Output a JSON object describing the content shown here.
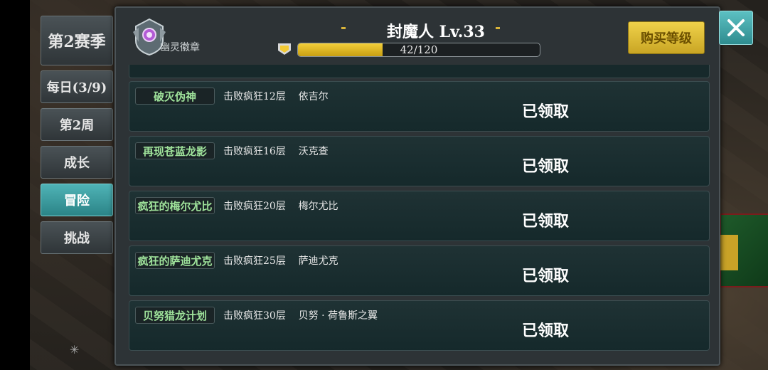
{
  "sidebar": {
    "season": "第2赛季",
    "daily": "每日(3/9)",
    "week": "第2周",
    "growth": "成长",
    "adventure": "冒险",
    "challenge": "挑战"
  },
  "header": {
    "badge_label": "幽灵徽章",
    "title": "封魔人 Lv.33",
    "xp_text": "42/120",
    "xp_progress": 0.35,
    "buy_label": "购买等级"
  },
  "quests": [
    {
      "name": "破灭伪神",
      "desc": "击败疯狂12层    依吉尔",
      "status": "已领取"
    },
    {
      "name": "再现苍蓝龙影",
      "desc": "击败疯狂16层    沃克查",
      "status": "已领取"
    },
    {
      "name": "疯狂的梅尔尤比",
      "desc": "击败疯狂20层    梅尔尤比",
      "status": "已领取"
    },
    {
      "name": "疯狂的萨迪尤克",
      "desc": "击败疯狂25层    萨迪尤克",
      "status": "已领取"
    },
    {
      "name": "贝努猎龙计划",
      "desc": "击败疯狂30层    贝努 · 荷鲁斯之翼",
      "status": "已领取"
    }
  ],
  "colors": {
    "accent": "#4fb3b6",
    "gold": "#e8c637",
    "quest_name": "#9fe39b"
  }
}
